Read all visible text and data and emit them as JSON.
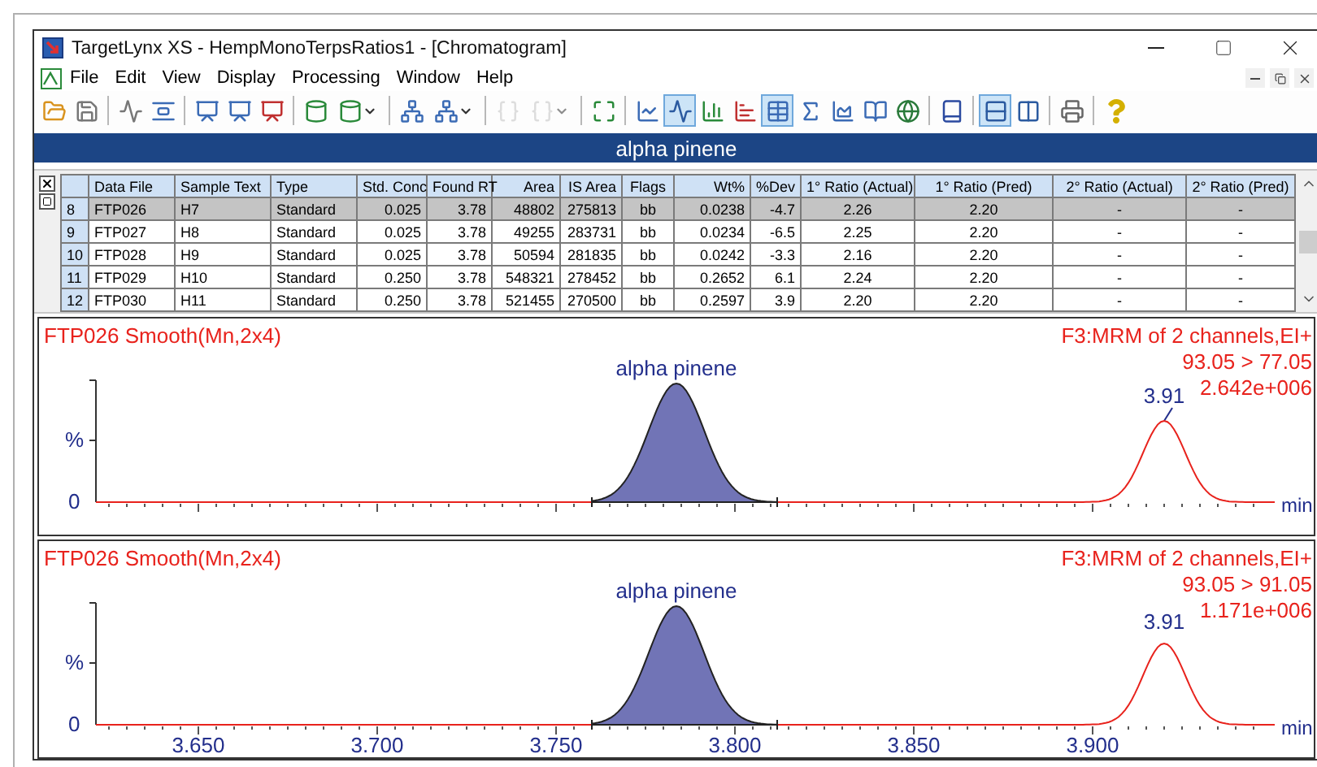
{
  "window": {
    "title": "TargetLynx XS - HempMonoTerpsRatios1 - [Chromatogram]"
  },
  "menu": [
    "File",
    "Edit",
    "View",
    "Display",
    "Processing",
    "Window",
    "Help"
  ],
  "toolbar": {
    "groups": [
      [
        {
          "selected": false,
          "disabled": false,
          "menu": false
        },
        {
          "selected": false,
          "disabled": false,
          "menu": false
        }
      ],
      [
        {
          "selected": false,
          "disabled": false,
          "menu": false
        },
        {
          "selected": false,
          "disabled": false,
          "menu": false
        }
      ],
      [
        {
          "selected": false,
          "disabled": false,
          "menu": false
        },
        {
          "selected": false,
          "disabled": false,
          "menu": false
        },
        {
          "selected": false,
          "disabled": false,
          "menu": false
        }
      ],
      [
        {
          "selected": false,
          "disabled": false,
          "menu": false
        },
        {
          "selected": false,
          "disabled": false,
          "menu": true
        }
      ],
      [
        {
          "selected": false,
          "disabled": false,
          "menu": false
        },
        {
          "selected": false,
          "disabled": false,
          "menu": true
        }
      ],
      [
        {
          "selected": false,
          "disabled": true,
          "menu": false
        },
        {
          "selected": false,
          "disabled": true,
          "menu": true
        }
      ],
      [
        {
          "selected": false,
          "disabled": false,
          "menu": false
        }
      ],
      [
        {
          "selected": false,
          "disabled": false,
          "menu": false
        },
        {
          "selected": true,
          "disabled": false,
          "menu": false
        },
        {
          "selected": false,
          "disabled": false,
          "menu": false
        },
        {
          "selected": false,
          "disabled": false,
          "menu": false
        },
        {
          "selected": true,
          "disabled": false,
          "menu": false
        },
        {
          "selected": false,
          "disabled": false,
          "menu": false
        },
        {
          "selected": false,
          "disabled": false,
          "menu": false
        },
        {
          "selected": false,
          "disabled": false,
          "menu": false
        },
        {
          "selected": false,
          "disabled": false,
          "menu": false
        }
      ],
      [
        {
          "selected": false,
          "disabled": false,
          "menu": false
        }
      ],
      [
        {
          "selected": true,
          "disabled": false,
          "menu": false
        },
        {
          "selected": false,
          "disabled": false,
          "menu": false
        }
      ],
      [
        {
          "selected": false,
          "disabled": false,
          "menu": false
        }
      ],
      [
        {
          "selected": false,
          "disabled": false,
          "menu": false
        }
      ]
    ]
  },
  "compound_header": "alpha pinene",
  "table": {
    "columns": [
      "Data File",
      "Sample Text",
      "Type",
      "Std. Conc",
      "Found RT",
      "Area",
      "IS Area",
      "Flags",
      "Wt%",
      "%Dev",
      "1° Ratio (Actual)",
      "1° Ratio (Pred)",
      "2° Ratio (Actual)",
      "2° Ratio (Pred)"
    ],
    "rows": [
      {
        "number": "8",
        "selected": true,
        "cells": [
          "FTP026",
          "H7",
          "Standard",
          "0.025",
          "3.78",
          "48802",
          "275813",
          "bb",
          "0.0238",
          "-4.7",
          "2.26",
          "2.20",
          "-",
          "-"
        ]
      },
      {
        "number": "9",
        "selected": false,
        "cells": [
          "FTP027",
          "H8",
          "Standard",
          "0.025",
          "3.78",
          "49255",
          "283731",
          "bb",
          "0.0234",
          "-6.5",
          "2.25",
          "2.20",
          "-",
          "-"
        ]
      },
      {
        "number": "10",
        "selected": false,
        "cells": [
          "FTP028",
          "H9",
          "Standard",
          "0.025",
          "3.78",
          "50594",
          "281835",
          "bb",
          "0.0242",
          "-3.3",
          "2.16",
          "2.20",
          "-",
          "-"
        ]
      },
      {
        "number": "11",
        "selected": false,
        "cells": [
          "FTP029",
          "H10",
          "Standard",
          "0.250",
          "3.78",
          "548321",
          "278452",
          "bb",
          "0.2652",
          "6.1",
          "2.24",
          "2.20",
          "-",
          "-"
        ]
      },
      {
        "number": "12",
        "selected": false,
        "cells": [
          "FTP030",
          "H11",
          "Standard",
          "0.250",
          "3.78",
          "521455",
          "270500",
          "bb",
          "0.2597",
          "3.9",
          "2.20",
          "2.20",
          "-",
          "-"
        ]
      }
    ]
  },
  "chromatograms": [
    {
      "title": "FTP026 Smooth(Mn,2x4)",
      "info": [
        "F3:MRM of 2 channels,EI+",
        "93.05 > 77.05",
        "2.642e+006"
      ],
      "peak_name": "alpha pinene",
      "peak_rt": "3.91",
      "leader": true,
      "y_labels": [
        "%",
        "0"
      ],
      "x_unit": "min"
    },
    {
      "title": "FTP026 Smooth(Mn,2x4)",
      "info": [
        "F3:MRM of 2 channels,EI+",
        "93.05 > 91.05",
        "1.171e+006"
      ],
      "peak_name": "alpha pinene",
      "peak_rt": "3.91",
      "leader": false,
      "y_labels": [
        "%",
        "0"
      ],
      "x_unit": "min",
      "x_ticks": [
        "3.650",
        "3.700",
        "3.750",
        "3.800",
        "3.850",
        "3.900"
      ]
    }
  ]
}
